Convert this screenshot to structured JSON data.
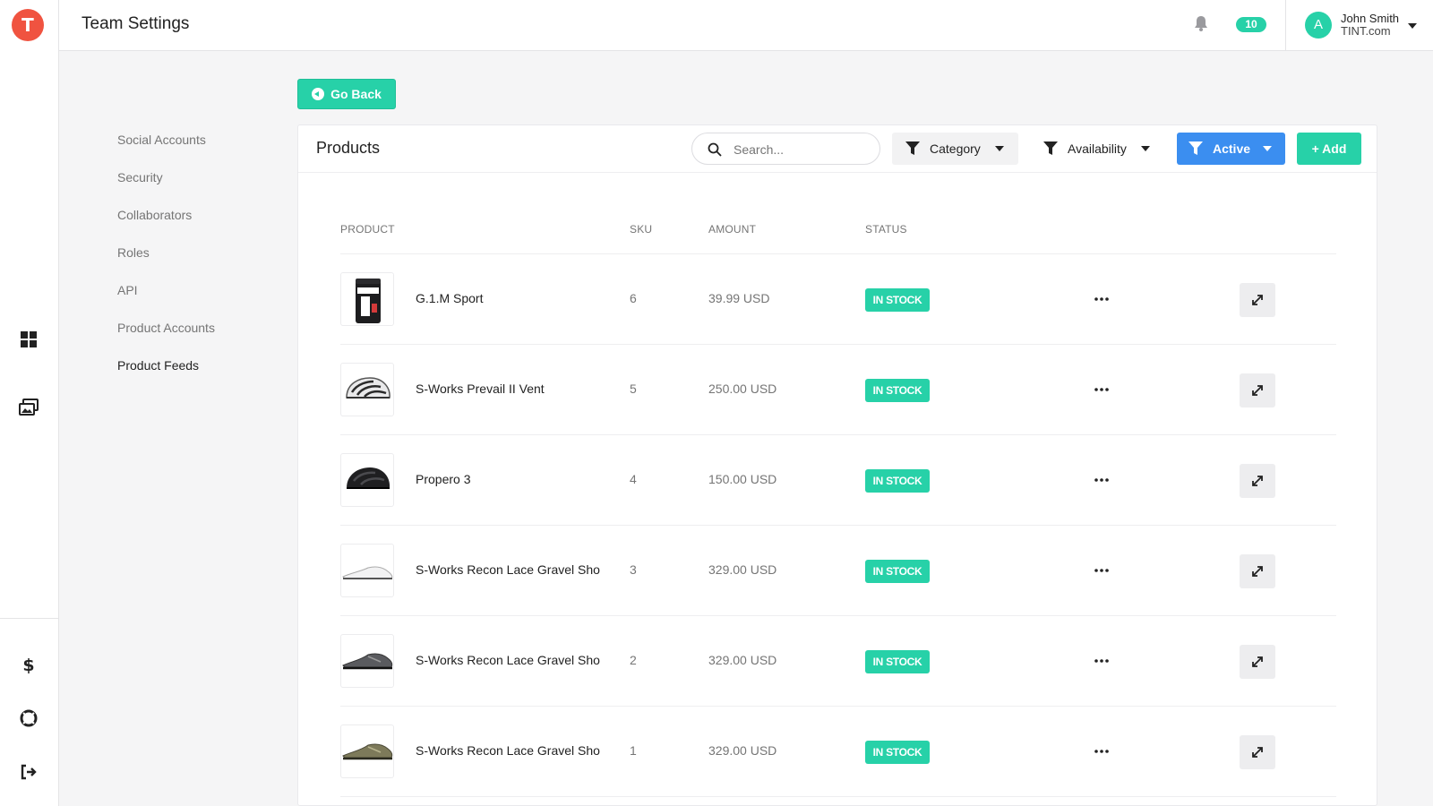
{
  "rail": {
    "logo_letter": "T",
    "icons": [
      "grid-icon",
      "gallery-icon",
      "dollar-icon",
      "lifebuoy-icon",
      "sign-out-icon"
    ]
  },
  "header": {
    "title": "Team Settings",
    "notification_count": "10",
    "user": {
      "avatar_letter": "A",
      "name": "John Smith",
      "org": "TINT.com"
    }
  },
  "go_back_label": "Go Back",
  "settings_nav": {
    "items": [
      {
        "label": "Social Accounts",
        "active": false
      },
      {
        "label": "Security",
        "active": false
      },
      {
        "label": "Collaborators",
        "active": false
      },
      {
        "label": "Roles",
        "active": false
      },
      {
        "label": "API",
        "active": false
      },
      {
        "label": "Product Accounts",
        "active": false
      },
      {
        "label": "Product Feeds",
        "active": true
      }
    ]
  },
  "products": {
    "title": "Products",
    "search_placeholder": "Search...",
    "filters": {
      "category": "Category",
      "availability": "Availability",
      "active": "Active"
    },
    "add_label": "+ Add",
    "columns": [
      "PRODUCT",
      "SKU",
      "AMOUNT",
      "STATUS"
    ],
    "rows": [
      {
        "name": "G.1.M Sport",
        "sku": "6",
        "amount": "39.99 USD",
        "status": "IN STOCK",
        "image": "supplement-tub"
      },
      {
        "name": "S-Works Prevail II Vent",
        "sku": "5",
        "amount": "250.00 USD",
        "status": "IN STOCK",
        "image": "white-helmet"
      },
      {
        "name": "Propero 3",
        "sku": "4",
        "amount": "150.00 USD",
        "status": "IN STOCK",
        "image": "black-helmet"
      },
      {
        "name": "S-Works Recon Lace Gravel Sho",
        "sku": "3",
        "amount": "329.00 USD",
        "status": "IN STOCK",
        "image": "white-shoe"
      },
      {
        "name": "S-Works Recon Lace Gravel Sho",
        "sku": "2",
        "amount": "329.00 USD",
        "status": "IN STOCK",
        "image": "grey-shoe"
      },
      {
        "name": "S-Works Recon Lace Gravel Sho",
        "sku": "1",
        "amount": "329.00 USD",
        "status": "IN STOCK",
        "image": "olive-shoe"
      }
    ]
  },
  "colors": {
    "accent_green": "#27d1a8",
    "active_blue": "#3b8ef0",
    "logo_red": "#f05340"
  }
}
